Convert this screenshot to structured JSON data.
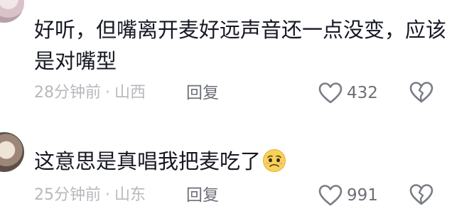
{
  "comments": [
    {
      "text": "好听，但嘴离开麦好远声音还一点没变，应该是对嘴型",
      "time": "28分钟前",
      "location": "山西",
      "reply_label": "回复",
      "like_count": "432",
      "avatar_icon": "user-avatar",
      "like_icon": "heart-outline-icon",
      "dislike_icon": "broken-heart-icon"
    },
    {
      "text": "这意思是真唱我把麦吃了",
      "emoji_icon": "anxious-face-emoji",
      "time": "25分钟前",
      "location": "山东",
      "reply_label": "回复",
      "like_count": "991",
      "avatar_icon": "user-avatar",
      "like_icon": "heart-outline-icon",
      "dislike_icon": "broken-heart-icon"
    }
  ],
  "meta_separator": "·",
  "colors": {
    "text": "#161823",
    "meta": "#b7b8bd",
    "action": "#6d6f78",
    "icon": "#7a7c85"
  }
}
